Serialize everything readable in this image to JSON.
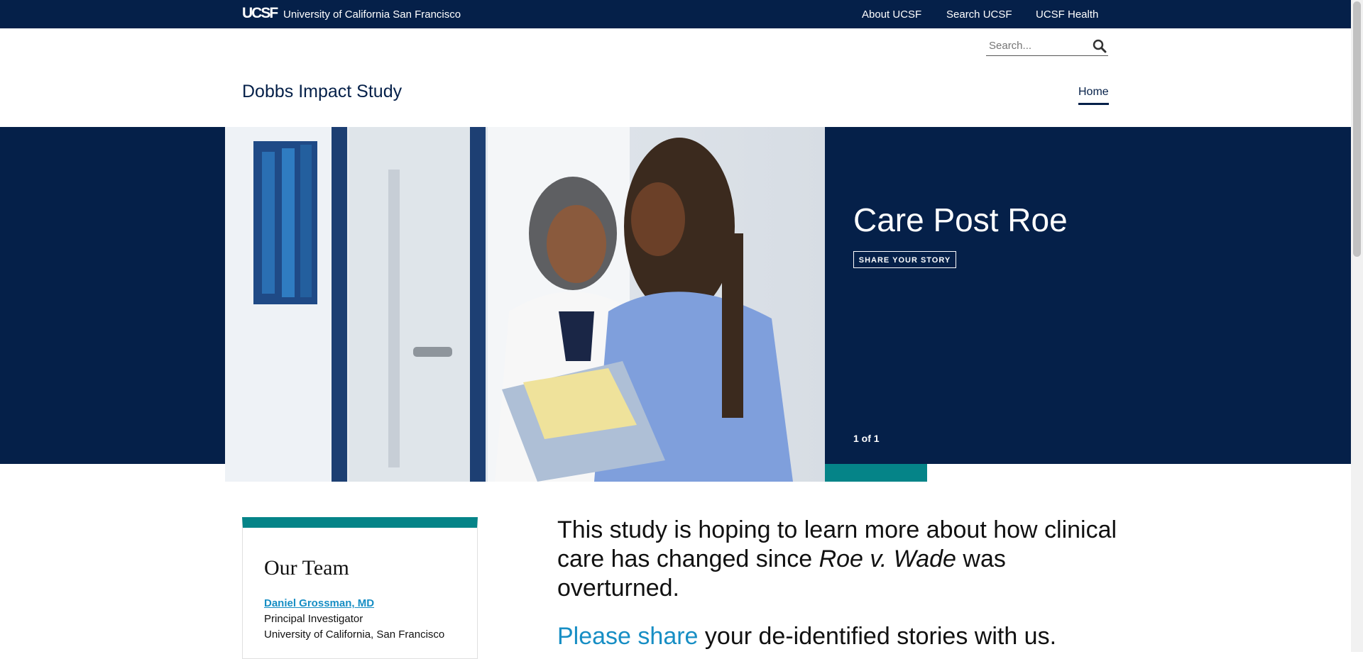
{
  "topbar": {
    "logo": "UCSF",
    "university": "University of California San Francisco",
    "links": [
      "About UCSF",
      "Search UCSF",
      "UCSF Health"
    ]
  },
  "search": {
    "placeholder": "Search..."
  },
  "site": {
    "title": "Dobbs Impact Study",
    "nav_home": "Home"
  },
  "hero": {
    "title": "Care Post Roe",
    "button": "SHARE YOUR STORY",
    "slide_counter": "1 of 1"
  },
  "team": {
    "heading": "Our Team",
    "members": [
      {
        "name": "Daniel Grossman, MD",
        "role": "Principal Investigator",
        "org": "University of California, San Francisco"
      }
    ]
  },
  "intro": {
    "text_before": "This study is hoping to learn more about how clinical care has changed since ",
    "italic": "Roe v. Wade",
    "text_after": " was overturned.",
    "share_link": "Please share",
    "share_rest": " your de-identified stories with us."
  },
  "colors": {
    "navy": "#052049",
    "teal": "#058488",
    "link": "#178ec4"
  }
}
